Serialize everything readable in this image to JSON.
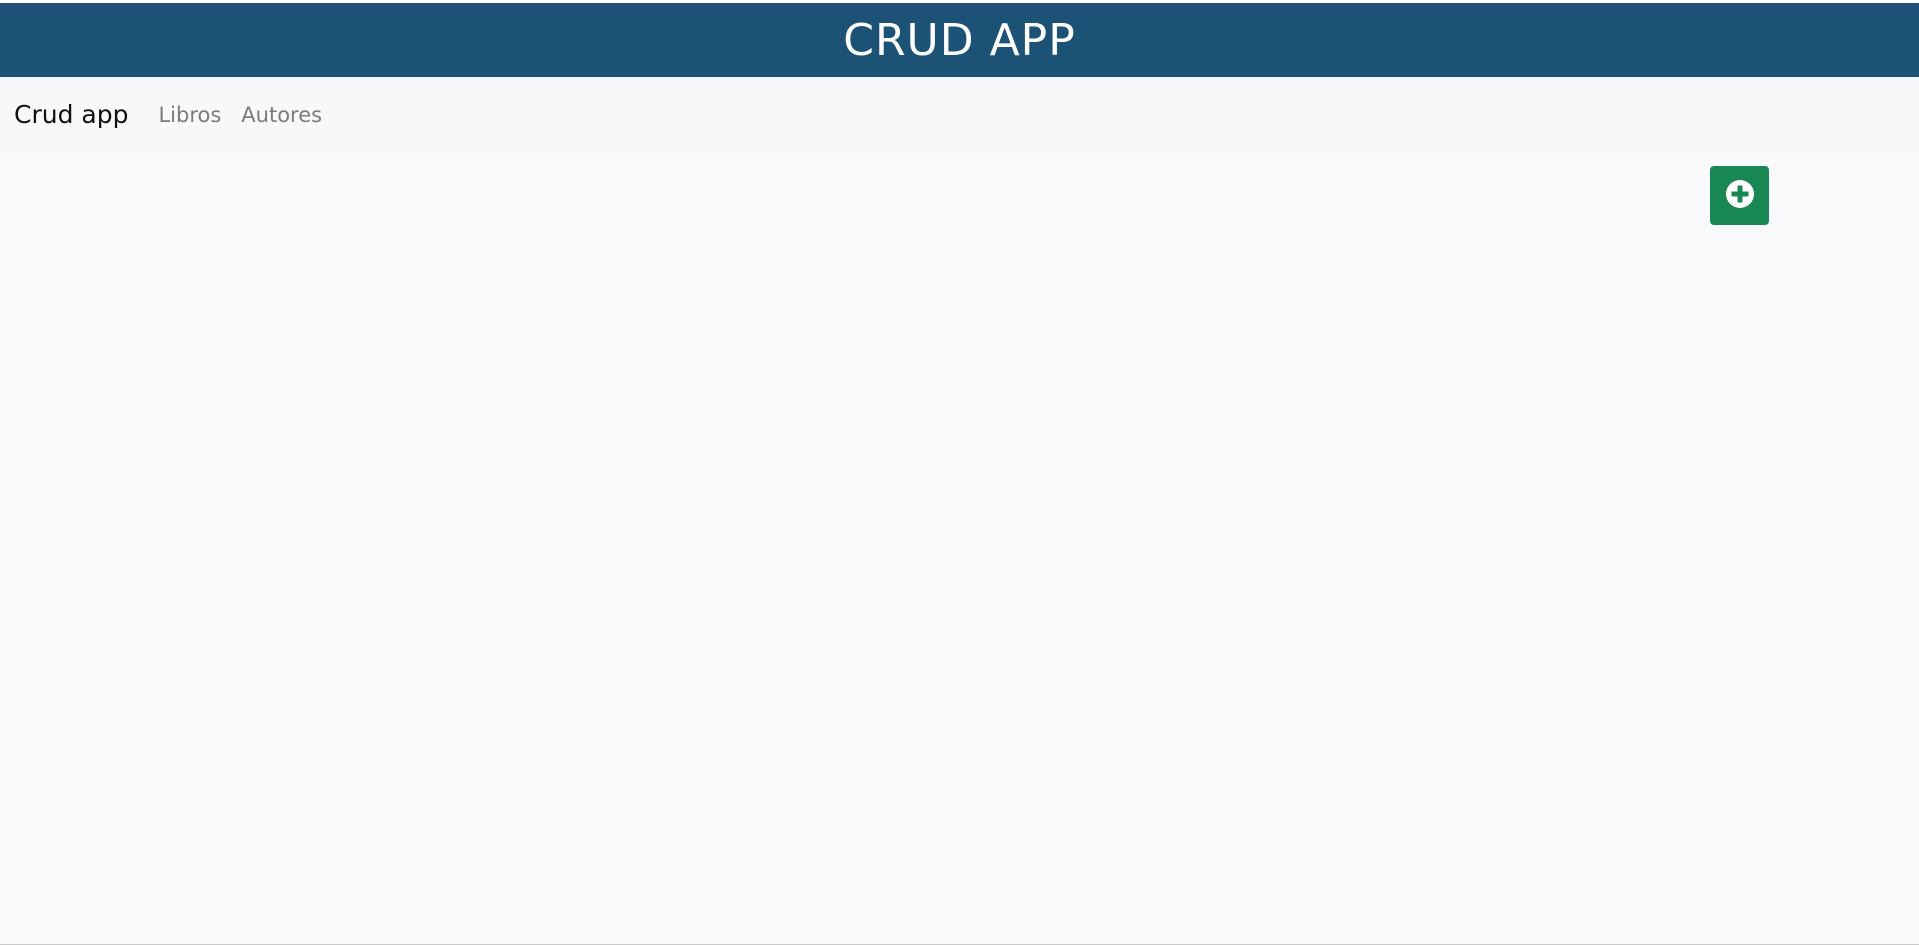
{
  "header": {
    "title": "CRUD APP"
  },
  "navbar": {
    "brand": "Crud app",
    "links": [
      {
        "label": "Libros"
      },
      {
        "label": "Autores"
      }
    ]
  },
  "toolbar": {
    "add_icon": "plus-circle-icon"
  },
  "colors": {
    "header_bg": "#1b5276",
    "add_button_bg": "#198754",
    "page_bg": "#f8f9fb"
  }
}
